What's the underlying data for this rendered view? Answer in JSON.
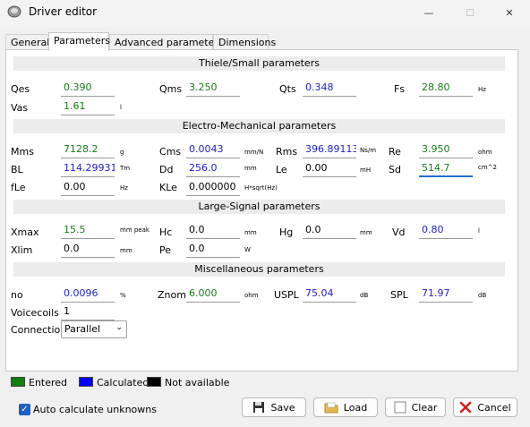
{
  "window": {
    "title": "Driver editor",
    "minimize": "—",
    "maximize": "☐",
    "close": "✕"
  },
  "tabs": [
    {
      "label": "General"
    },
    {
      "label": "Parameters"
    },
    {
      "label": "Advanced parameters"
    },
    {
      "label": "Dimensions"
    }
  ],
  "sections": {
    "thiele": "Thiele/Small parameters",
    "electro": "Electro-Mechanical parameters",
    "large": "Large-Signal parameters",
    "misc": "Miscellaneous parameters"
  },
  "params": {
    "qes": {
      "label": "Qes",
      "value": "0.390",
      "unit": ""
    },
    "qms": {
      "label": "Qms",
      "value": "3.250",
      "unit": ""
    },
    "qts": {
      "label": "Qts",
      "value": "0.348",
      "unit": ""
    },
    "fs": {
      "label": "Fs",
      "value": "28.80",
      "unit": "Hz"
    },
    "vas": {
      "label": "Vas",
      "value": "1.61",
      "unit": "l"
    },
    "mms": {
      "label": "Mms",
      "value": "7128.2",
      "unit": "g"
    },
    "cms": {
      "label": "Cms",
      "value": "0.0043",
      "unit": "mm/N"
    },
    "rms": {
      "label": "Rms",
      "value": "396.89113",
      "unit": "Ns/m"
    },
    "re": {
      "label": "Re",
      "value": "3.950",
      "unit": "ohm"
    },
    "bl": {
      "label": "BL",
      "value": "114.29931",
      "unit": "Tm"
    },
    "dd": {
      "label": "Dd",
      "value": "256.0",
      "unit": "mm"
    },
    "le": {
      "label": "Le",
      "value": "0.00",
      "unit": "mH"
    },
    "sd": {
      "label": "Sd",
      "value": "514.7",
      "unit": "cm^2"
    },
    "fle": {
      "label": "fLe",
      "value": "0.00",
      "unit": "Hz"
    },
    "kle": {
      "label": "KLe",
      "value": "0.000000",
      "unit": "H*sqrt(Hz)"
    },
    "xmax": {
      "label": "Xmax",
      "value": "15.5",
      "unit": "mm peak"
    },
    "hc": {
      "label": "Hc",
      "value": "0.0",
      "unit": "mm"
    },
    "hg": {
      "label": "Hg",
      "value": "0.0",
      "unit": "mm"
    },
    "vd": {
      "label": "Vd",
      "value": "0.80",
      "unit": "l"
    },
    "xlim": {
      "label": "Xlim",
      "value": "0.0",
      "unit": "mm"
    },
    "pe": {
      "label": "Pe",
      "value": "0.0",
      "unit": "W"
    },
    "no": {
      "label": "no",
      "value": "0.0096",
      "unit": "%"
    },
    "znom": {
      "label": "Znom",
      "value": "6.000",
      "unit": "ohm"
    },
    "uspl": {
      "label": "USPL",
      "value": "75.04",
      "unit": "dB"
    },
    "spl": {
      "label": "SPL",
      "value": "71.97",
      "unit": "dB"
    },
    "voicecoils": {
      "label": "Voicecoils",
      "value": "1"
    },
    "connection": {
      "label": "Connection",
      "value": "Parallel"
    }
  },
  "legend": {
    "entered": {
      "label": "Entered",
      "color": "#108010"
    },
    "calculated": {
      "label": "Calculated",
      "color": "#0000ff"
    },
    "na": {
      "label": "Not available",
      "color": "#000000"
    }
  },
  "auto_calc": {
    "label": "Auto calculate unknowns",
    "checked": true
  },
  "buttons": {
    "save": "Save",
    "load": "Load",
    "clear": "Clear",
    "cancel": "Cancel"
  }
}
